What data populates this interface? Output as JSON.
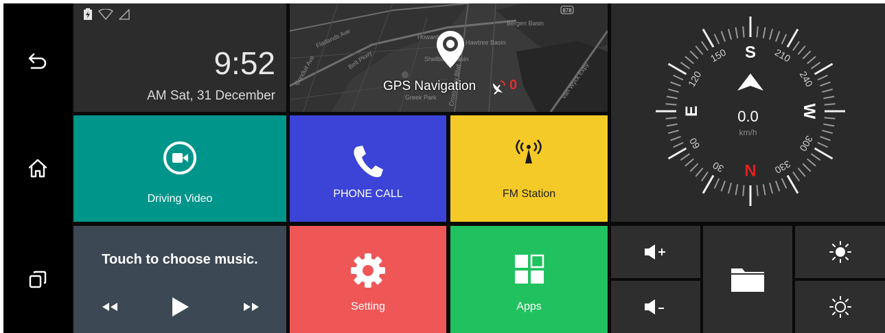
{
  "nav": {
    "back_icon": "back-arrow-icon",
    "home_icon": "home-icon",
    "recents_icon": "recent-apps-icon"
  },
  "status_bar": {
    "icons": [
      "battery-charging-icon",
      "wifi-icon",
      "signal-icon"
    ]
  },
  "clock": {
    "time": "9:52",
    "date": "AM Sat, 31 December"
  },
  "gps": {
    "label": "GPS Navigation",
    "satellites": "0",
    "map_labels": [
      "Flatlands Ave",
      "Belt Pkwy",
      "Howard Beach",
      "Hawtree Basin",
      "Shellbank Basin",
      "Bergen Basin",
      "Greek Park",
      "Van Wyck Expy",
      "Conduit Ave",
      "Cross Bay Blvd"
    ],
    "road_shield": "878"
  },
  "compass": {
    "speed": "0.0",
    "unit": "km/h",
    "cardinal": [
      "E",
      "S",
      "W",
      "N"
    ],
    "degrees": [
      "30",
      "60",
      "120",
      "150",
      "210",
      "240",
      "300",
      "330"
    ]
  },
  "tiles": {
    "driving_video": "Driving Video",
    "phone_call": "PHONE CALL",
    "fm_station": "FM Station",
    "setting": "Setting",
    "apps": "Apps"
  },
  "music": {
    "title": "Touch to choose music."
  },
  "controls": {
    "volume_up_icon": "volume-up-icon",
    "volume_down_icon": "volume-down-icon",
    "files_icon": "folder-icon",
    "brightness_up_icon": "brightness-up-icon",
    "brightness_down_icon": "brightness-down-icon"
  },
  "colors": {
    "driving_video": "#00958a",
    "phone_call": "#3b44d6",
    "fm_station": "#f4ca28",
    "music": "#3c4853",
    "setting": "#ef5656",
    "apps": "#21c15f",
    "compass_north": "#e02020"
  }
}
